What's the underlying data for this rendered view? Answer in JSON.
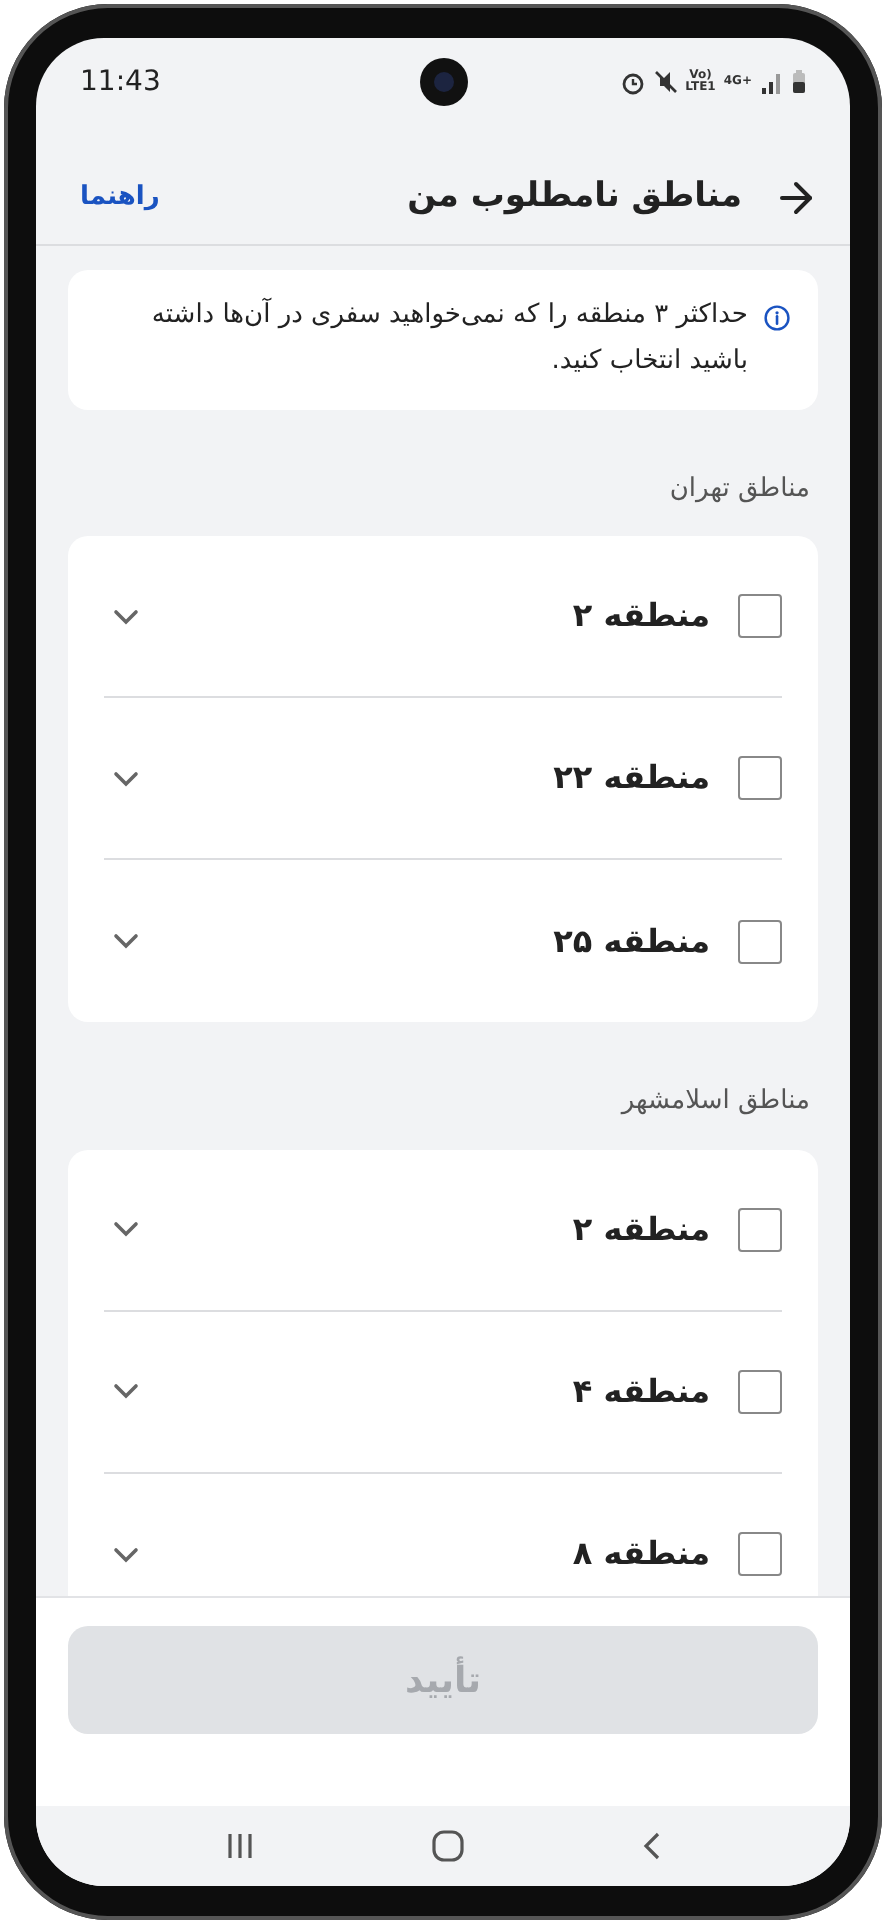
{
  "status_bar": {
    "time": "11:43",
    "network_labels": [
      "Vo)",
      "LTE1",
      "4G+"
    ]
  },
  "header": {
    "title": "مناطق نامطلوب من",
    "help_link": "راهنما"
  },
  "info": "حداکثر ۳ منطقه را که نمی‌خواهید سفری در آن‌ها داشته باشید انتخاب کنید.",
  "sections": [
    {
      "title": "مناطق تهران",
      "items": [
        {
          "label": "منطقه ۲",
          "checked": false,
          "expanded": false
        },
        {
          "label": "منطقه ۲۲",
          "checked": false,
          "expanded": false
        },
        {
          "label": "منطقه ۲۵",
          "checked": false,
          "expanded": false
        }
      ]
    },
    {
      "title": "مناطق اسلامشهر",
      "items": [
        {
          "label": "منطقه ۲",
          "checked": false,
          "expanded": false
        },
        {
          "label": "منطقه ۴",
          "checked": false,
          "expanded": false
        },
        {
          "label": "منطقه ۸",
          "checked": false,
          "expanded": false
        }
      ]
    }
  ],
  "confirm_button": {
    "label": "تأیید",
    "disabled": true
  }
}
